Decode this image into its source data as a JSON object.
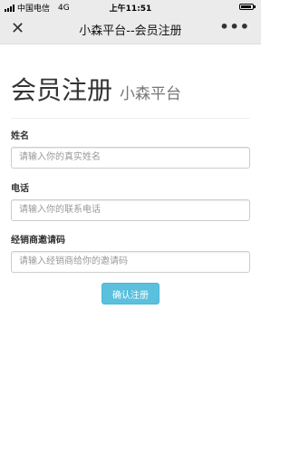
{
  "status_bar": {
    "carrier": "中国电信",
    "network": "4G",
    "time": "上午11:51",
    "battery_level": 0.9
  },
  "nav": {
    "title": "小森平台--会员注册",
    "close_icon": "close-icon",
    "more_icon": "more-icon"
  },
  "page": {
    "title": "会员注册",
    "subtitle": "小森平台"
  },
  "form": {
    "name": {
      "label": "姓名",
      "placeholder": "请输入你的真实姓名",
      "value": ""
    },
    "phone": {
      "label": "电话",
      "placeholder": "请输入你的联系电话",
      "value": ""
    },
    "invite": {
      "label": "经销商邀请码",
      "placeholder": "请输入经销商给你的邀请码",
      "value": ""
    },
    "submit_label": "确认注册"
  },
  "colors": {
    "submit_bg": "#5bc0de",
    "bar_bg": "#ebebeb"
  }
}
